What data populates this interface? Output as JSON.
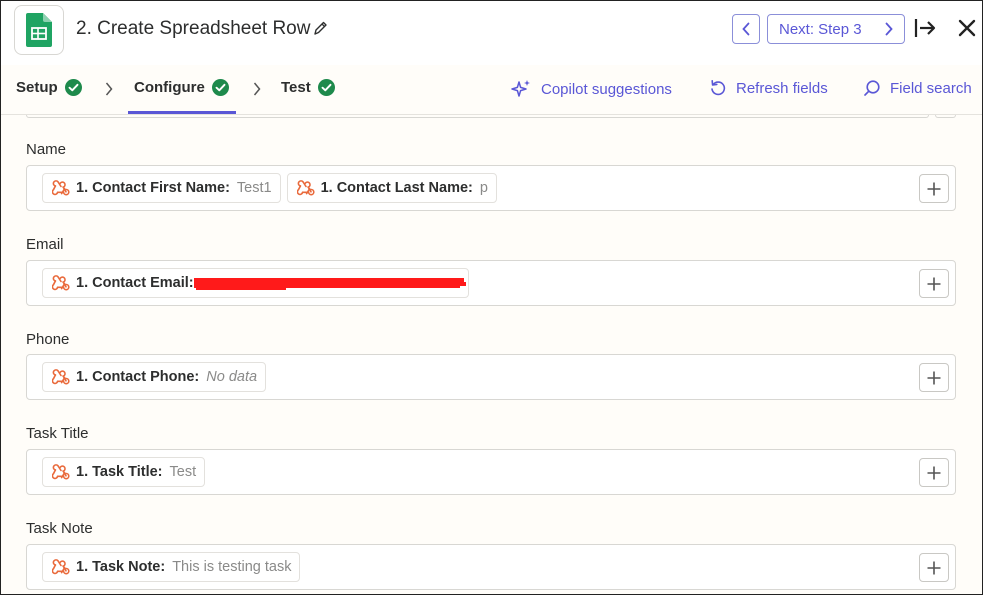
{
  "header": {
    "title": "2. Create Spreadsheet Row",
    "next_label": "Next: Step 3"
  },
  "tabs": [
    {
      "label": "Setup"
    },
    {
      "label": "Configure"
    },
    {
      "label": "Test"
    }
  ],
  "actions": {
    "copilot": "Copilot suggestions",
    "refresh": "Refresh fields",
    "search": "Field search"
  },
  "fields": [
    {
      "label": "Name",
      "pills": [
        {
          "key": "1. Contact First Name:",
          "value": "Test1"
        },
        {
          "key": "1. Contact Last Name:",
          "value": "p"
        }
      ]
    },
    {
      "label": "Email",
      "pills": [
        {
          "key": "1. Contact Email:",
          "value": ""
        }
      ]
    },
    {
      "label": "Phone",
      "pills": [
        {
          "key": "1. Contact Phone:",
          "value": "No data"
        }
      ]
    },
    {
      "label": "Task Title",
      "pills": [
        {
          "key": "1. Task Title:",
          "value": "Test"
        }
      ]
    },
    {
      "label": "Task Note",
      "pills": [
        {
          "key": "1. Task Note:",
          "value": "This is testing task"
        }
      ]
    }
  ],
  "colors": {
    "accent": "#5a57d6",
    "check": "#1e8a4c",
    "zap": "#e96a3c",
    "sheets": "#1fa463",
    "redaction": "#ff1a1a"
  }
}
